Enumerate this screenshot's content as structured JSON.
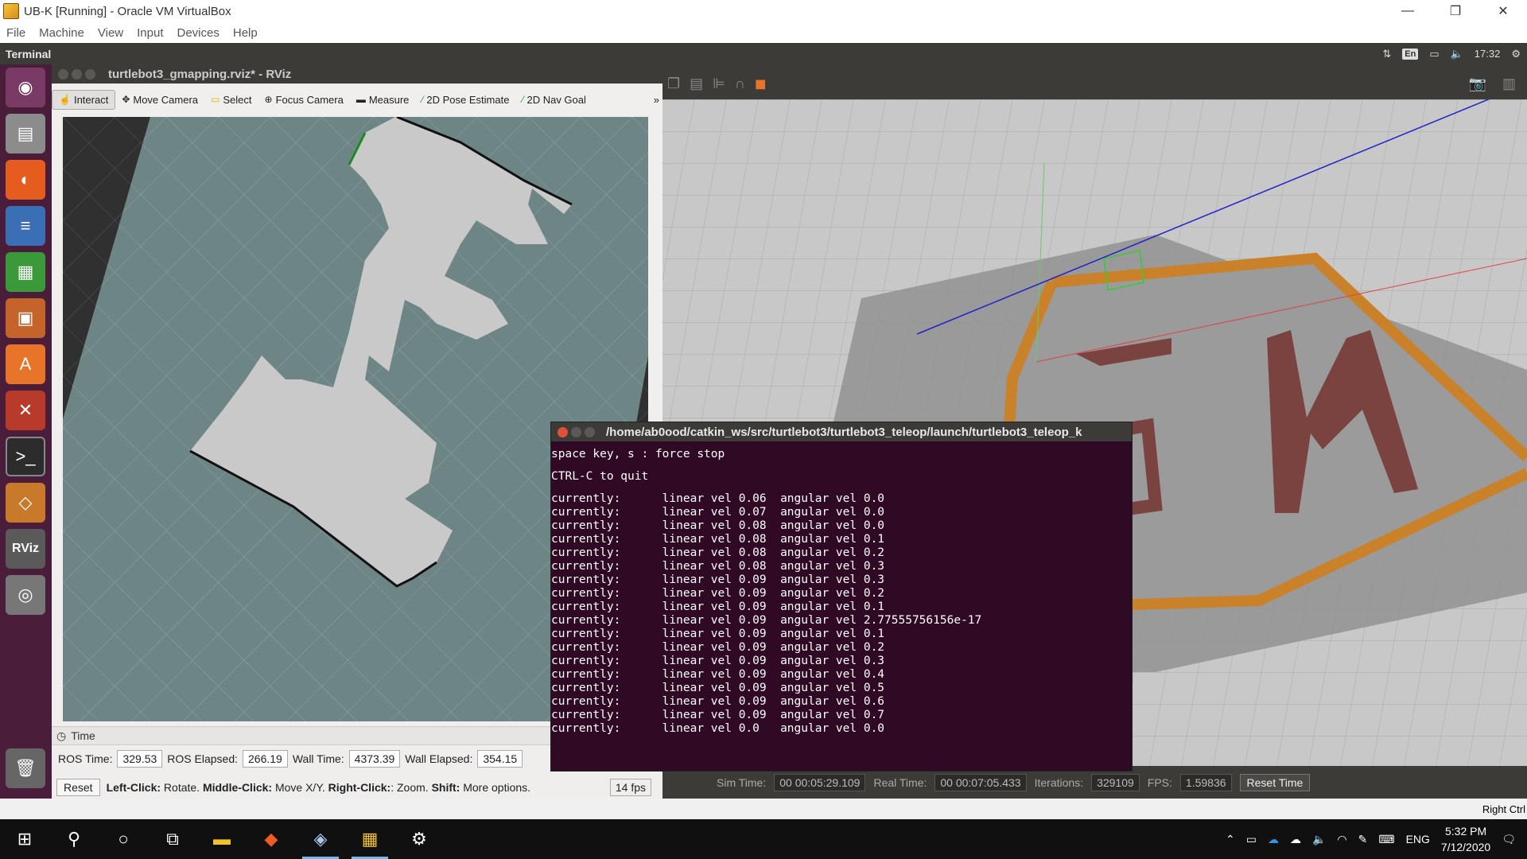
{
  "host_window": {
    "title": "UB-K [Running] - Oracle VM VirtualBox",
    "controls": [
      "—",
      "❐",
      "✕"
    ],
    "menu": [
      "File",
      "Machine",
      "View",
      "Input",
      "Devices",
      "Help"
    ]
  },
  "ubuntu_panel": {
    "active_app": "Terminal",
    "keyboard": "En",
    "time": "17:32"
  },
  "launcher": {
    "items": [
      "ubuntu-dash",
      "files",
      "firefox",
      "libreoffice-writer",
      "libreoffice-calc",
      "libreoffice-impress",
      "software-center",
      "system-settings",
      "terminal",
      "virtualbox",
      "rviz",
      "dvd",
      "trash"
    ],
    "rviz_label": "RViz"
  },
  "rviz": {
    "title": "turtlebot3_gmapping.rviz* - RViz",
    "tools": [
      "Interact",
      "Move Camera",
      "Select",
      "Focus Camera",
      "Measure",
      "2D Pose Estimate",
      "2D Nav Goal"
    ],
    "time_panel": {
      "header": "Time",
      "ros_time_label": "ROS Time:",
      "ros_time": "329.53",
      "ros_elapsed_label": "ROS Elapsed:",
      "ros_elapsed": "266.19",
      "wall_time_label": "Wall Time:",
      "wall_time": "4373.39",
      "wall_elapsed_label": "Wall Elapsed:",
      "wall_elapsed": "354.15"
    },
    "status": {
      "reset": "Reset",
      "hint_left": "Left-Click:",
      "hint_left_text": " Rotate. ",
      "hint_mid": "Middle-Click:",
      "hint_mid_text": " Move X/Y. ",
      "hint_right": "Right-Click:",
      "hint_right_text": ": Zoom. ",
      "hint_shift": "Shift:",
      "hint_shift_text": " More options.",
      "fps": "14 fps"
    }
  },
  "terminal": {
    "title": "/home/ab0ood/catkin_ws/src/turtlebot3/turtlebot3_teleop/launch/turtlebot3_teleop_k",
    "lines": [
      "space key, s : force stop",
      "",
      "CTRL-C to quit",
      "",
      "currently:      linear vel 0.06  angular vel 0.0",
      "currently:      linear vel 0.07  angular vel 0.0",
      "currently:      linear vel 0.08  angular vel 0.0",
      "currently:      linear vel 0.08  angular vel 0.1",
      "currently:      linear vel 0.08  angular vel 0.2",
      "currently:      linear vel 0.08  angular vel 0.3",
      "currently:      linear vel 0.09  angular vel 0.3",
      "currently:      linear vel 0.09  angular vel 0.2",
      "currently:      linear vel 0.09  angular vel 0.1",
      "currently:      linear vel 0.09  angular vel 2.77555756156e-17",
      "currently:      linear vel 0.09  angular vel 0.1",
      "currently:      linear vel 0.09  angular vel 0.2",
      "currently:      linear vel 0.09  angular vel 0.3",
      "currently:      linear vel 0.09  angular vel 0.4",
      "currently:      linear vel 0.09  angular vel 0.5",
      "currently:      linear vel 0.09  angular vel 0.6",
      "currently:      linear vel 0.09  angular vel 0.7",
      "currently:      linear vel 0.0   angular vel 0.0"
    ]
  },
  "gazebo": {
    "footer": {
      "sim_time_label": "Sim Time:",
      "sim_time": "00 00:05:29.109",
      "real_time_label": "Real Time:",
      "real_time": "00 00:07:05.433",
      "iterations_label": "Iterations:",
      "iterations": "329109",
      "fps_label": "FPS:",
      "fps": "1.59836",
      "reset_time": "Reset Time"
    }
  },
  "vbox_status": {
    "host_key": "Right Ctrl"
  },
  "taskbar": {
    "language": "ENG",
    "time": "5:32 PM",
    "date": "7/12/2020"
  }
}
